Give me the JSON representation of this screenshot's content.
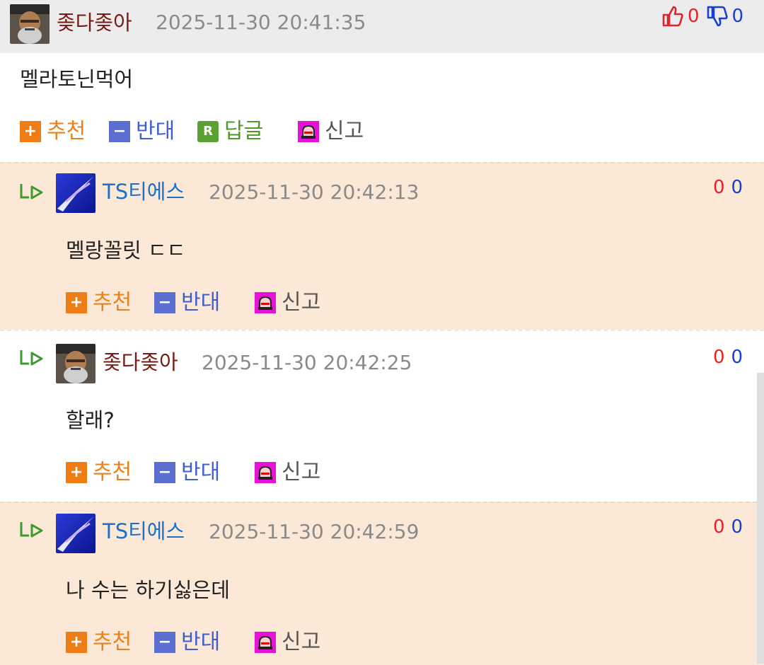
{
  "main_comment": {
    "author": "좆다좆아",
    "datetime": "2025-11-30 20:41:35",
    "text": "멜라토닌먹어",
    "up_count": "0",
    "down_count": "0",
    "actions": {
      "recommend": "추천",
      "oppose": "반대",
      "reply": "답글",
      "report": "신고"
    }
  },
  "replies": [
    {
      "author": "TS티에스",
      "datetime": "2025-11-30 20:42:13",
      "text": "멜랑꼴릿 ㄷㄷ",
      "up_count": "0",
      "down_count": "0",
      "actions": {
        "recommend": "추천",
        "oppose": "반대",
        "report": "신고"
      }
    },
    {
      "author": "좆다좆아",
      "datetime": "2025-11-30 20:42:25",
      "text": "할래?",
      "up_count": "0",
      "down_count": "0",
      "actions": {
        "recommend": "추천",
        "oppose": "반대",
        "report": "신고"
      }
    },
    {
      "author": "TS티에스",
      "datetime": "2025-11-30 20:42:59",
      "text": "나 수는 하기싫은데",
      "up_count": "0",
      "down_count": "0",
      "actions": {
        "recommend": "추천",
        "oppose": "반대",
        "report": "신고"
      }
    }
  ],
  "icons": {
    "thumbs_up": "thumbs-up-icon",
    "thumbs_down": "thumbs-down-icon",
    "reply_arrow": "reply-arrow-icon",
    "plus": "plus-icon",
    "minus": "minus-icon",
    "reply_r": "reply-r-icon",
    "alarm": "alarm-icon"
  },
  "colors": {
    "reply_bg": "#fce8d6",
    "header_bg": "#ececec",
    "recommend": "#e8811e",
    "oppose": "#3f5fcf",
    "reply": "#4e9a2b",
    "upvote": "#e0242a",
    "downvote": "#1a3fd0"
  }
}
